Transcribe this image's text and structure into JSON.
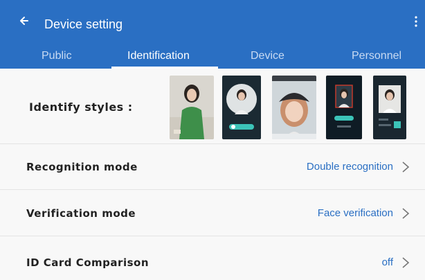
{
  "header": {
    "title": "Device setting",
    "tabs": [
      {
        "label": "Public",
        "active": false
      },
      {
        "label": "Identification",
        "active": true
      },
      {
        "label": "Device",
        "active": false
      },
      {
        "label": "Personnel",
        "active": false
      }
    ]
  },
  "settings": {
    "identify_styles": {
      "label": "Identify styles :"
    },
    "recognition_mode": {
      "label": "Recognition mode",
      "value": "Double recognition"
    },
    "verification_mode": {
      "label": "Verification mode",
      "value": "Face verification"
    },
    "id_card_comparison": {
      "label": "ID Card Comparison",
      "value": "off"
    }
  },
  "colors": {
    "accent": "#2a6fc3",
    "text": "#222222",
    "value": "#2a6fc3"
  },
  "icons": {
    "back": "arrow-left-icon",
    "more": "more-vert-icon",
    "chevron": "chevron-right-icon"
  }
}
